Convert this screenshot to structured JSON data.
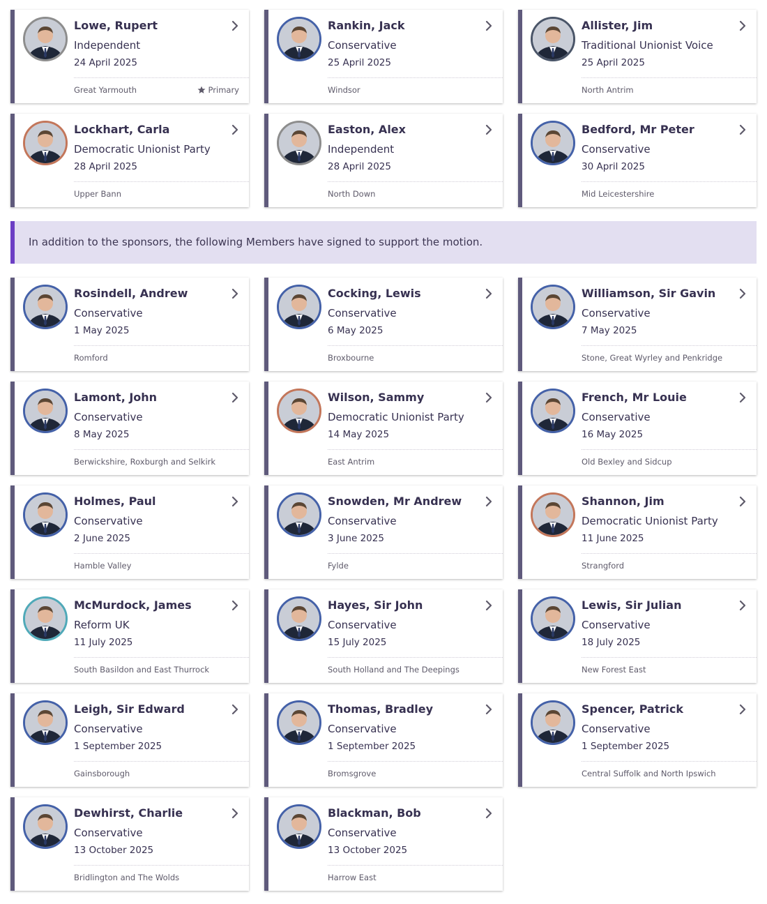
{
  "colors": {
    "card_border": "#5f5a7c",
    "banner_bg": "#e3dff1",
    "banner_accent": "#6c3fc4",
    "party_conservative": "#4461a8",
    "party_independent": "#8d8d8d",
    "party_dup": "#c3765a",
    "party_tuv": "#4a5568",
    "party_reform": "#4fa9b8"
  },
  "icons": {
    "card_link": "chevron-right-icon",
    "primary_marker": "star-icon"
  },
  "sponsors": [
    {
      "name": "Lowe, Rupert",
      "party": "Independent",
      "date": "24 April 2025",
      "constituency": "Great Yarmouth",
      "primary_label": "Primary",
      "ring": "#8d8d8d"
    },
    {
      "name": "Rankin, Jack",
      "party": "Conservative",
      "date": "25 April 2025",
      "constituency": "Windsor",
      "ring": "#4461a8"
    },
    {
      "name": "Allister, Jim",
      "party": "Traditional Unionist Voice",
      "date": "25 April 2025",
      "constituency": "North Antrim",
      "ring": "#4a5568"
    },
    {
      "name": "Lockhart, Carla",
      "party": "Democratic Unionist Party",
      "date": "28 April 2025",
      "constituency": "Upper Bann",
      "ring": "#c3765a"
    },
    {
      "name": "Easton, Alex",
      "party": "Independent",
      "date": "28 April 2025",
      "constituency": "North Down",
      "ring": "#8d8d8d"
    },
    {
      "name": "Bedford, Mr Peter",
      "party": "Conservative",
      "date": "30 April 2025",
      "constituency": "Mid Leicestershire",
      "ring": "#4461a8"
    }
  ],
  "banner": {
    "text": "In addition to the sponsors, the following Members have signed to support the motion."
  },
  "signers": [
    {
      "name": "Rosindell, Andrew",
      "party": "Conservative",
      "date": "1 May 2025",
      "constituency": "Romford",
      "ring": "#4461a8"
    },
    {
      "name": "Cocking, Lewis",
      "party": "Conservative",
      "date": "6 May 2025",
      "constituency": "Broxbourne",
      "ring": "#4461a8"
    },
    {
      "name": "Williamson, Sir Gavin",
      "party": "Conservative",
      "date": "7 May 2025",
      "constituency": "Stone, Great Wyrley and Penkridge",
      "ring": "#4461a8"
    },
    {
      "name": "Lamont, John",
      "party": "Conservative",
      "date": "8 May 2025",
      "constituency": "Berwickshire, Roxburgh and Selkirk",
      "ring": "#4461a8"
    },
    {
      "name": "Wilson, Sammy",
      "party": "Democratic Unionist Party",
      "date": "14 May 2025",
      "constituency": "East Antrim",
      "ring": "#c3765a"
    },
    {
      "name": "French, Mr Louie",
      "party": "Conservative",
      "date": "16 May 2025",
      "constituency": "Old Bexley and Sidcup",
      "ring": "#4461a8"
    },
    {
      "name": "Holmes, Paul",
      "party": "Conservative",
      "date": "2 June 2025",
      "constituency": "Hamble Valley",
      "ring": "#4461a8"
    },
    {
      "name": "Snowden, Mr Andrew",
      "party": "Conservative",
      "date": "3 June 2025",
      "constituency": "Fylde",
      "ring": "#4461a8"
    },
    {
      "name": "Shannon, Jim",
      "party": "Democratic Unionist Party",
      "date": "11 June 2025",
      "constituency": "Strangford",
      "ring": "#c3765a"
    },
    {
      "name": "McMurdock, James",
      "party": "Reform UK",
      "date": "11 July 2025",
      "constituency": "South Basildon and East Thurrock",
      "ring": "#4fa9b8"
    },
    {
      "name": "Hayes, Sir John",
      "party": "Conservative",
      "date": "15 July 2025",
      "constituency": "South Holland and The Deepings",
      "ring": "#4461a8"
    },
    {
      "name": "Lewis, Sir Julian",
      "party": "Conservative",
      "date": "18 July 2025",
      "constituency": "New Forest East",
      "ring": "#4461a8"
    },
    {
      "name": "Leigh, Sir Edward",
      "party": "Conservative",
      "date": "1 September 2025",
      "constituency": "Gainsborough",
      "ring": "#4461a8"
    },
    {
      "name": "Thomas, Bradley",
      "party": "Conservative",
      "date": "1 September 2025",
      "constituency": "Bromsgrove",
      "ring": "#4461a8"
    },
    {
      "name": "Spencer, Patrick",
      "party": "Conservative",
      "date": "1 September 2025",
      "constituency": "Central Suffolk and North Ipswich",
      "ring": "#4461a8"
    },
    {
      "name": "Dewhirst, Charlie",
      "party": "Conservative",
      "date": "13 October 2025",
      "constituency": "Bridlington and The Wolds",
      "ring": "#4461a8"
    },
    {
      "name": "Blackman, Bob",
      "party": "Conservative",
      "date": "13 October 2025",
      "constituency": "Harrow East",
      "ring": "#4461a8"
    }
  ]
}
